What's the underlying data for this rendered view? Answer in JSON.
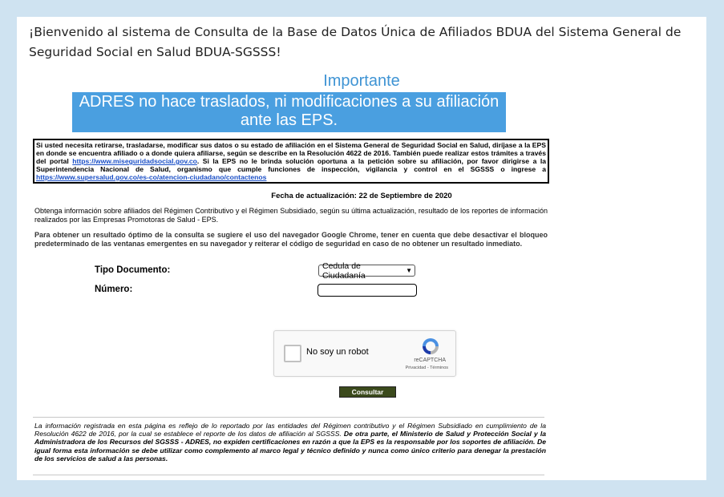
{
  "welcome_text": "¡Bienvenido al sistema de Consulta de la Base de Datos Única de Afiliados BDUA del Sistema General de Seguridad Social en Salud BDUA-SGSSS!",
  "importante_title": "Importante",
  "banner_text": "ADRES no hace traslados, ni modificaciones a su afiliación ante las EPS.",
  "notice": {
    "part1": "Si usted necesita retirarse, trasladarse, modificar sus datos o su estado de afiliación en el Sistema General de Seguridad Social en Salud, diríjase a la EPS en donde se encuentra afiliado o a donde quiera afiliarse, según se describe en la Resolución 4622 de 2016. También puede realizar estos trámites a través del portal ",
    "link1": "https://www.miseguridadsocial.gov.co",
    "part2": ". Si la EPS no le brinda solución oportuna a la petición sobre su afiliación, por favor dirigirse a la Superintendencia Nacional de Salud, organismo que cumple funciones de inspección, vigilancia y control en el SGSSS o ingrese a ",
    "link2": "https://www.supersalud.gov.co/es-co/atencion-ciudadano/contactenos"
  },
  "fecha": "Fecha de actualización: 22 de Septiembre de 2020",
  "obtenga": "Obtenga información sobre afiliados del Régimen Contributivo y el Régimen Subsidiado, según su última actualización, resultado de los reportes de información realizados por las Empresas Promotoras de Salud - EPS.",
  "chrome_note": "Para obtener un resultado óptimo de la consulta se sugiere el uso del navegador Google Chrome, tener en cuenta que debe desactivar el bloqueo predeterminado de las ventanas emergentes en su navegador y reiterar el código de seguridad en caso de no obtener un resultado inmediato.",
  "form": {
    "tipo_label": "Tipo Documento:",
    "tipo_value": "Cedula de Ciudadanía",
    "numero_label": "Número:",
    "numero_value": ""
  },
  "captcha": {
    "label": "No soy un robot",
    "brand": "reCAPTCHA",
    "legal": "Privacidad - Términos"
  },
  "consultar_label": "Consultar",
  "footer": {
    "part1": "La información registrada en esta página es reflejo de lo reportado por las entidades del Régimen contributivo y el Régimen Subsidiado en cumplimiento de la Resolución 4622 de 2016, por la cual se establece el reporte de los datos de afiliación al SGSSS. ",
    "part2": "De otra parte, el Ministerio de Salud y Protección Social y la Administradora de los Recursos del SGSSS - ADRES, no expiden certificaciones en razón a que la EPS es la responsable por los soportes de afiliación. De igual forma esta información se debe utilizar como complemento al marco legal y técnico definido y nunca como único criterio para denegar la prestación de los servicios de salud a las personas."
  },
  "colors": {
    "page_bg": "#cfe3f1",
    "banner_blue": "#4a9fe0",
    "title_blue": "#3f94d4",
    "button_green": "#3b4a1c",
    "link_blue": "#1a4fc7"
  }
}
